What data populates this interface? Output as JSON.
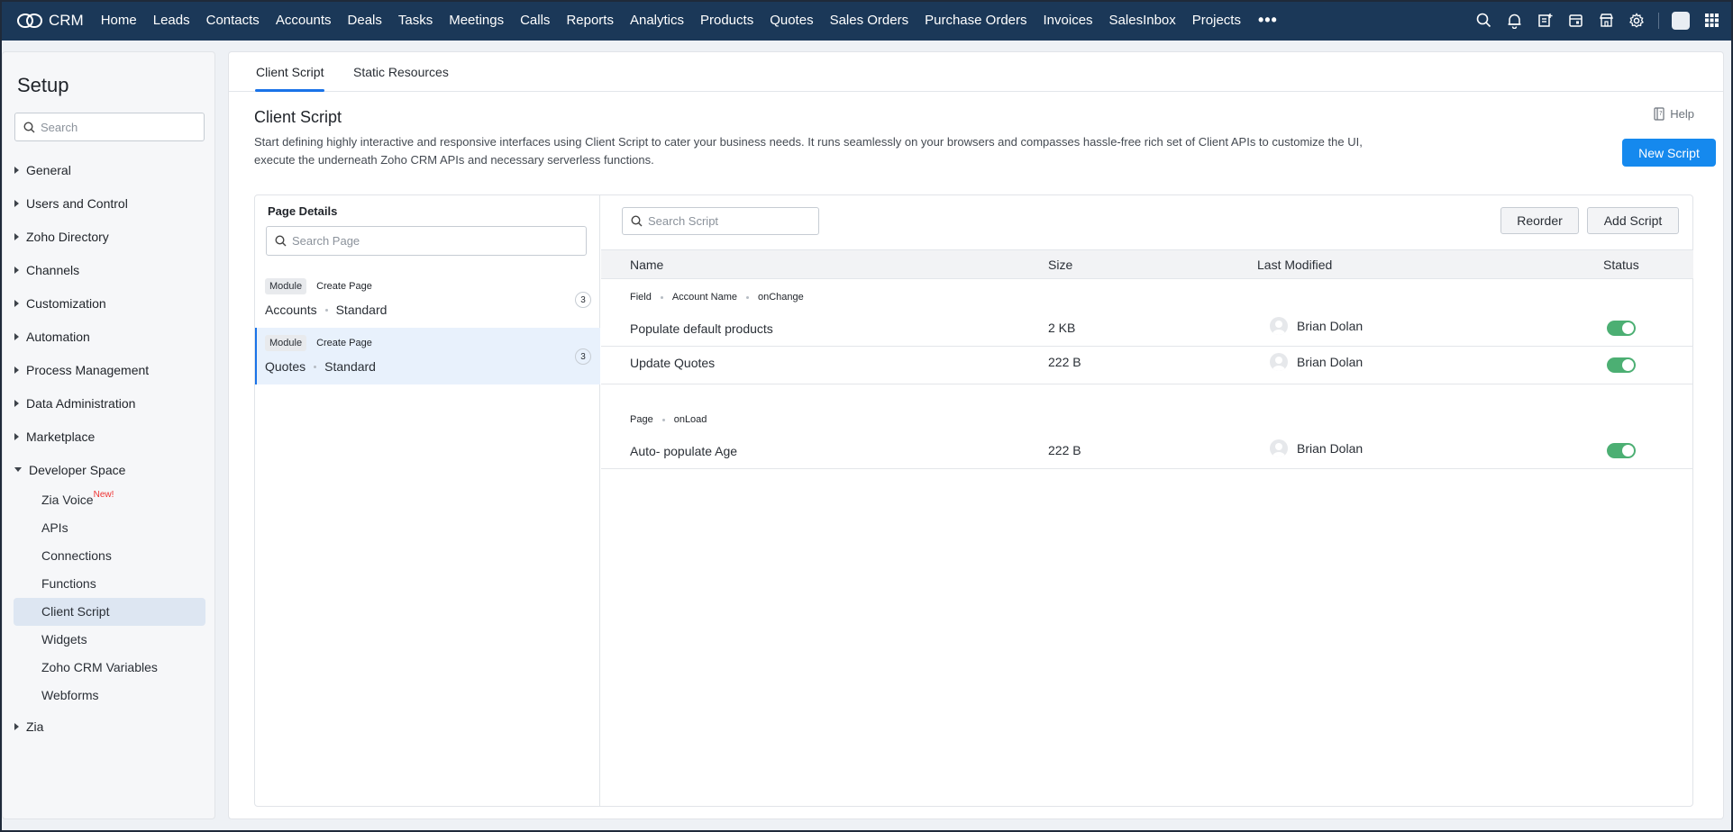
{
  "app": {
    "name": "CRM"
  },
  "nav": {
    "items": [
      "Home",
      "Leads",
      "Contacts",
      "Accounts",
      "Deals",
      "Tasks",
      "Meetings",
      "Calls",
      "Reports",
      "Analytics",
      "Products",
      "Quotes",
      "Sales Orders",
      "Purchase Orders",
      "Invoices",
      "SalesInbox",
      "Projects"
    ],
    "more": "•••"
  },
  "sidebar": {
    "title": "Setup",
    "search_placeholder": "Search",
    "sections": [
      "General",
      "Users and Control",
      "Zoho Directory",
      "Channels",
      "Customization",
      "Automation",
      "Process Management",
      "Data Administration",
      "Marketplace"
    ],
    "developer_space": {
      "label": "Developer Space",
      "items": [
        "Zia Voice",
        "APIs",
        "Connections",
        "Functions",
        "Client Script",
        "Widgets",
        "Zoho CRM Variables",
        "Webforms"
      ],
      "new_badge": "New!"
    },
    "last_section": "Zia"
  },
  "tabs": {
    "client_script": "Client Script",
    "static_resources": "Static Resources"
  },
  "header": {
    "title": "Client Script",
    "description": "Start defining highly interactive and responsive interfaces using Client Script to cater your business needs. It runs seamlessly on your browsers and compasses hassle-free rich set of Client APIs to customize the UI, execute the underneath Zoho CRM APIs and necessary serverless functions.",
    "help": "Help",
    "new_script": "New Script"
  },
  "page_details": {
    "title": "Page Details",
    "search_placeholder": "Search Page",
    "pages": [
      {
        "chip": "Module",
        "type": "Create Page",
        "module": "Accounts",
        "layout": "Standard",
        "count": "3"
      },
      {
        "chip": "Module",
        "type": "Create Page",
        "module": "Quotes",
        "layout": "Standard",
        "count": "3"
      }
    ]
  },
  "scripts": {
    "search_placeholder": "Search Script",
    "reorder": "Reorder",
    "add_script": "Add Script",
    "columns": {
      "name": "Name",
      "size": "Size",
      "last_modified": "Last Modified",
      "status": "Status"
    },
    "groups": [
      {
        "labels": [
          "Field",
          "Account Name",
          "onChange"
        ],
        "rows": [
          {
            "name": "Populate default products",
            "size": "2 KB",
            "user": "Brian Dolan",
            "enabled": true
          },
          {
            "name": "Update Quotes",
            "size": "222 B",
            "user": "Brian Dolan",
            "enabled": true
          }
        ]
      },
      {
        "labels": [
          "Page",
          "onLoad"
        ],
        "rows": [
          {
            "name": "Auto- populate Age",
            "size": "222 B",
            "user": "Brian Dolan",
            "enabled": true
          }
        ]
      }
    ]
  },
  "colors": {
    "topbar": "#1b3858",
    "primary": "#1589ee",
    "toggle_on": "#4caf73",
    "selected_bg": "#e8f1fc"
  }
}
